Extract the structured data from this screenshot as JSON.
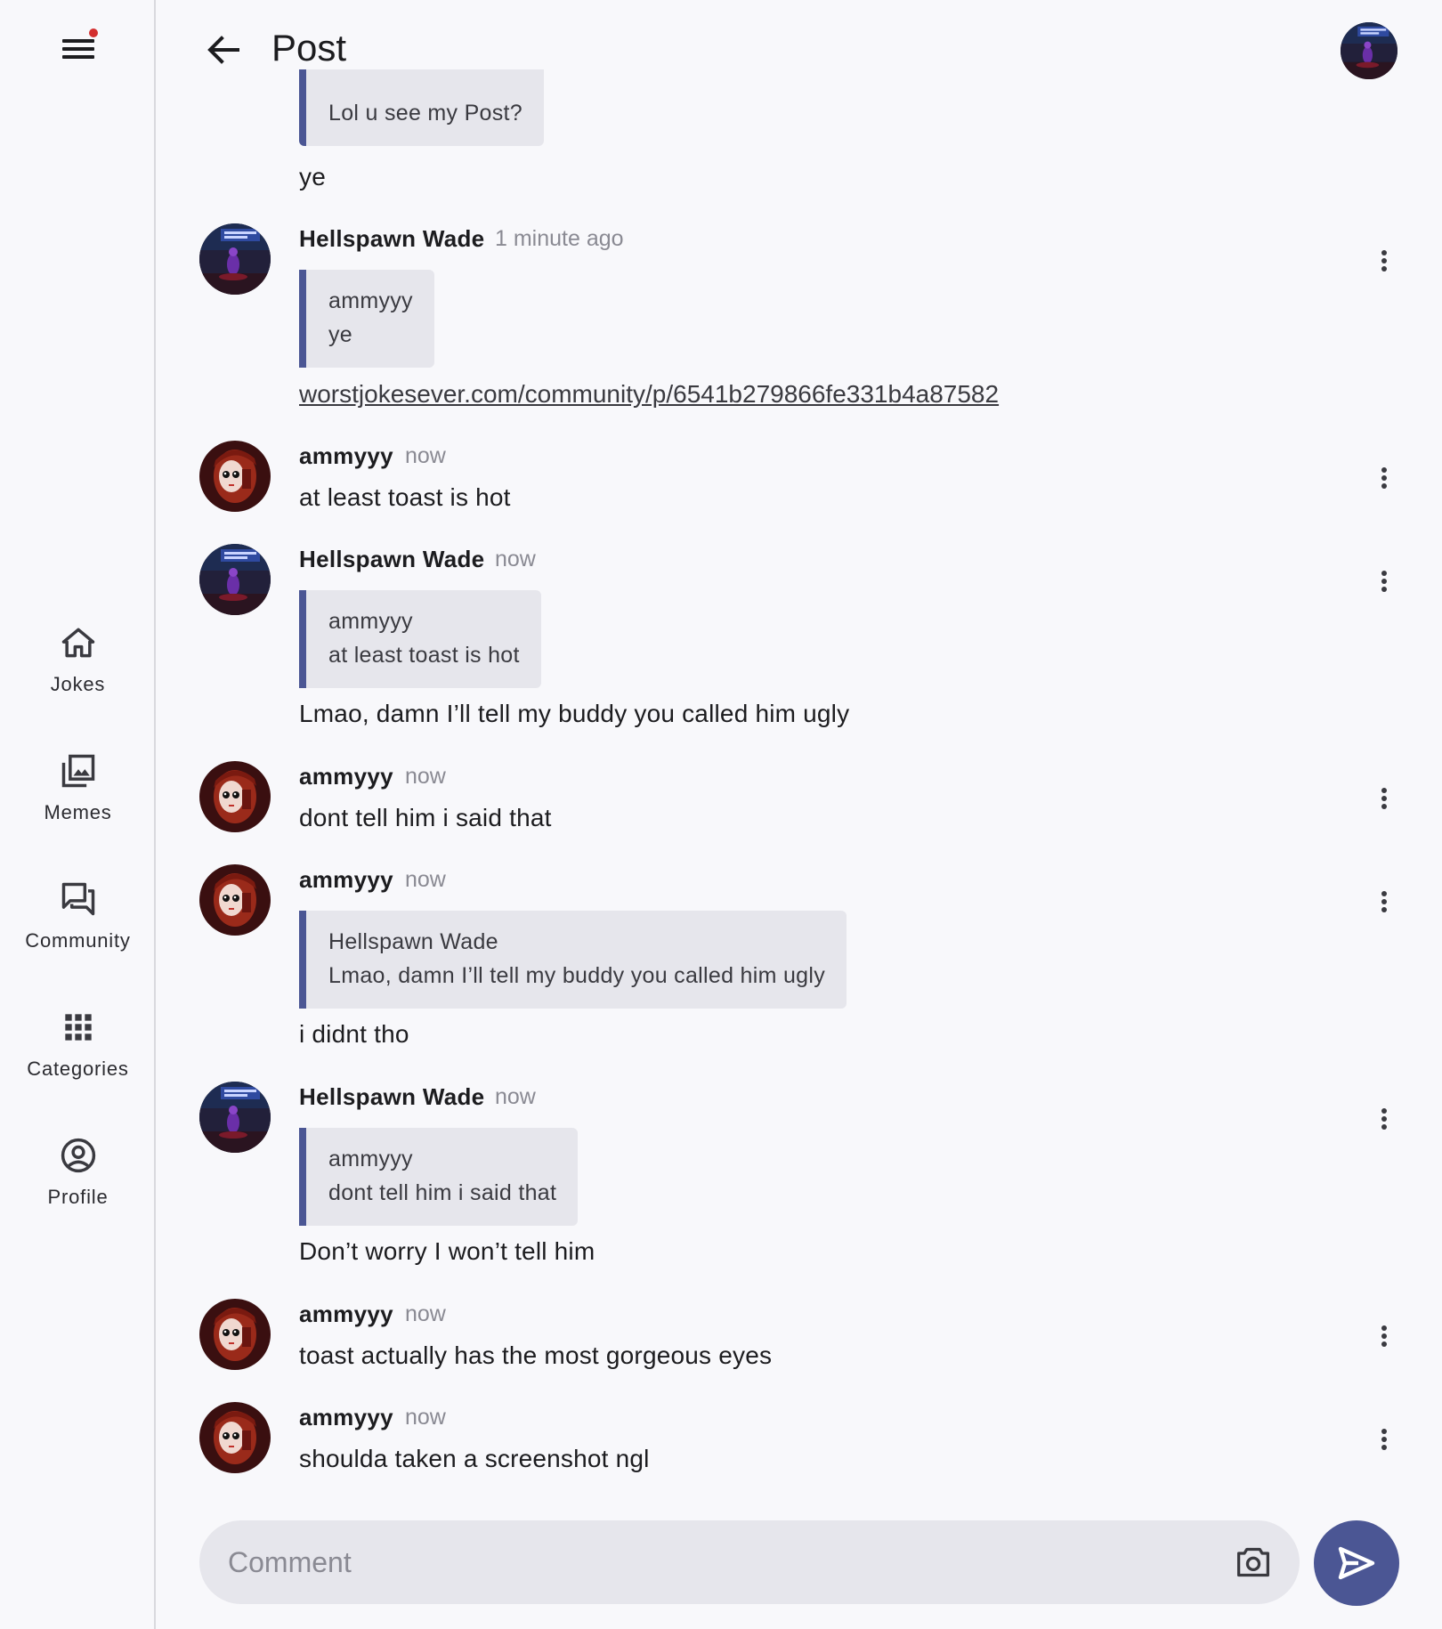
{
  "header": {
    "title": "Post"
  },
  "sidebar": {
    "items": [
      {
        "label": "Jokes",
        "icon": "home-icon"
      },
      {
        "label": "Memes",
        "icon": "image-gallery-icon"
      },
      {
        "label": "Community",
        "icon": "forum-icon"
      },
      {
        "label": "Categories",
        "icon": "apps-grid-icon"
      },
      {
        "label": "Profile",
        "icon": "account-circle-icon"
      }
    ]
  },
  "feed": {
    "top_partial": {
      "quote_text": "Lol u see my Post?",
      "text": "ye"
    },
    "messages": [
      {
        "user": "Hellspawn Wade",
        "time": "1 minute ago",
        "quote_user": "ammyyy",
        "quote_text": "ye",
        "link": "worstjokesever.com/community/p/6541b279866fe331b4a87582"
      },
      {
        "user": "ammyyy",
        "time": "now",
        "text": "at least toast is hot"
      },
      {
        "user": "Hellspawn Wade",
        "time": "now",
        "quote_user": "ammyyy",
        "quote_text": "at least toast is hot",
        "text": "Lmao, damn I’ll tell my buddy you called him ugly"
      },
      {
        "user": "ammyyy",
        "time": "now",
        "text": "dont tell him i said that"
      },
      {
        "user": "ammyyy",
        "time": "now",
        "quote_user": "Hellspawn Wade",
        "quote_text": "Lmao, damn I’ll tell my buddy you called him ugly",
        "text": "i didnt tho"
      },
      {
        "user": "Hellspawn Wade",
        "time": "now",
        "quote_user": "ammyyy",
        "quote_text": "dont tell him i said that",
        "text": "Don’t worry I won’t tell him"
      },
      {
        "user": "ammyyy",
        "time": "now",
        "text": "toast actually has the most gorgeous eyes"
      },
      {
        "user": "ammyyy",
        "time": "now",
        "text": "shoulda taken a screenshot ngl"
      }
    ]
  },
  "comment": {
    "placeholder": "Comment"
  },
  "colors": {
    "accent": "#4b5694",
    "quote_bg": "#e6e6ec",
    "notification": "#d32f2f"
  }
}
